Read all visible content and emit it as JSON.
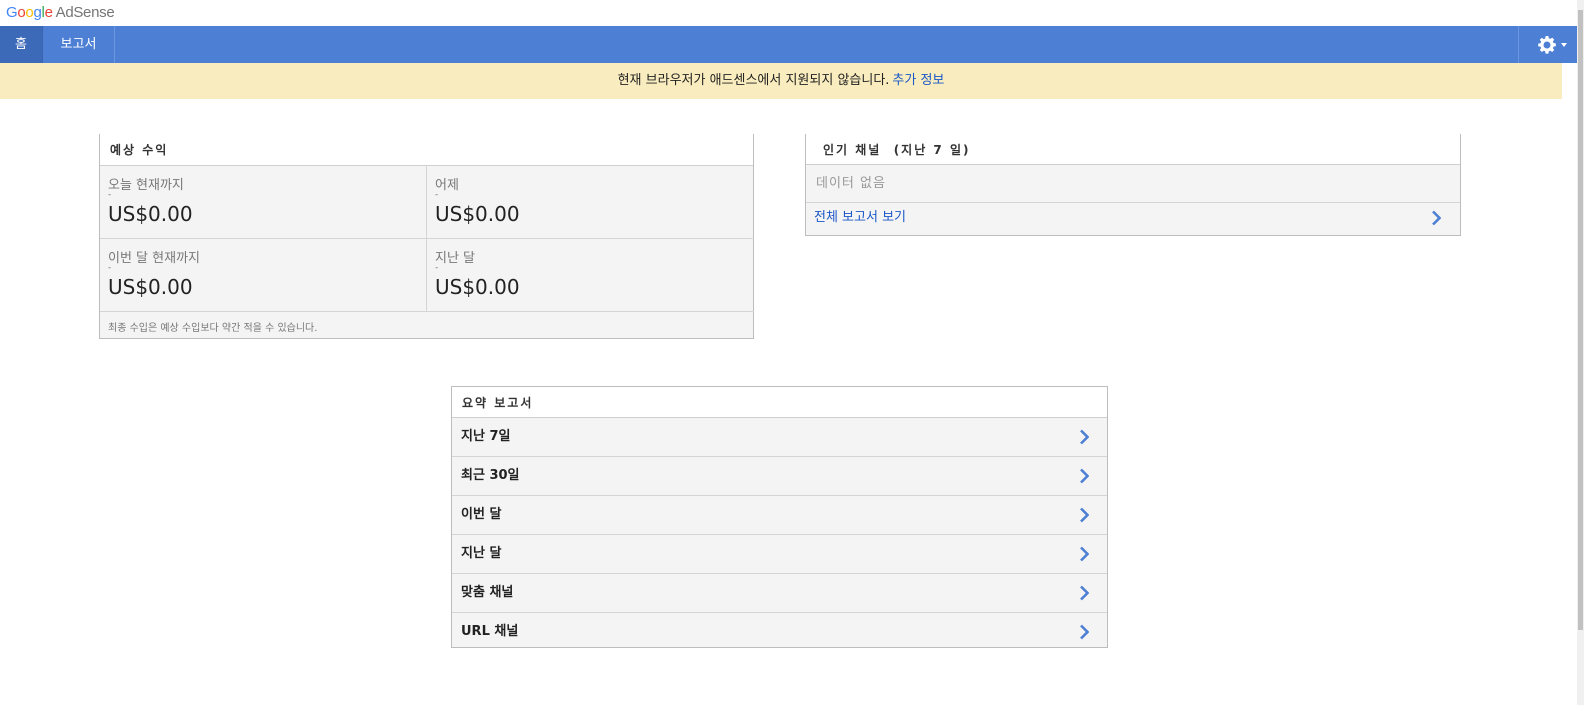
{
  "brand": {
    "logo_letters": [
      "G",
      "o",
      "o",
      "g",
      "l",
      "e"
    ],
    "product": "AdSense"
  },
  "nav": {
    "home": "홈",
    "reports": "보고서",
    "settings_icon": "gear-icon",
    "color": "#4d80d5"
  },
  "notice": {
    "text": "현재 브라우저가 애드센스에서 지원되지 않습니다.",
    "link": "추가 정보",
    "bg": "#f9ecbe"
  },
  "earnings": {
    "title": "예상 수익",
    "metrics": [
      {
        "label": "오늘 현재까지",
        "dash": "-",
        "value": "US$0.00"
      },
      {
        "label": "어제",
        "dash": "-",
        "value": "US$0.00"
      },
      {
        "label": "이번 달 현재까지",
        "dash": "-",
        "value": "US$0.00"
      },
      {
        "label": "지난 달",
        "dash": "-",
        "value": "US$0.00"
      }
    ],
    "note": "최종 수입은 예상 수입보다 약간 적을 수 있습니다."
  },
  "channels": {
    "title": "인기 채널  (지난 7 일)",
    "empty": "데이터 없음",
    "link": "전체 보고서 보기"
  },
  "summary": {
    "title": "요약 보고서",
    "rows": [
      "지난 7일",
      "최근 30일",
      "이번 달",
      "지난 달",
      "맞춤 채널",
      "URL 채널"
    ]
  }
}
